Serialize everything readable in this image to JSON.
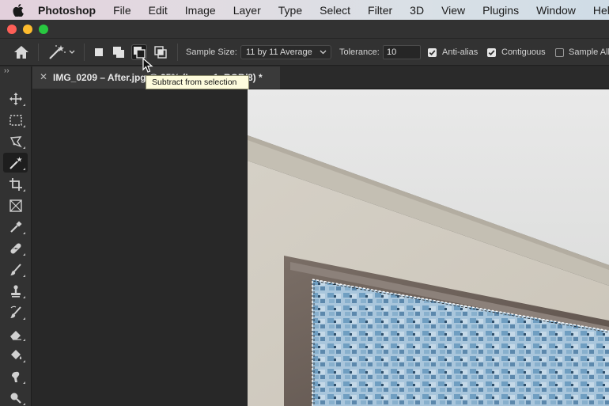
{
  "menubar": {
    "app_name": "Photoshop",
    "items": [
      "File",
      "Edit",
      "Image",
      "Layer",
      "Type",
      "Select",
      "Filter",
      "3D",
      "View",
      "Plugins",
      "Window",
      "Help"
    ]
  },
  "options_bar": {
    "sample_size_label": "Sample Size:",
    "sample_size_value": "11 by 11 Average",
    "tolerance_label": "Tolerance:",
    "tolerance_value": "10",
    "anti_alias_label": "Anti-alias",
    "anti_alias_checked": true,
    "contiguous_label": "Contiguous",
    "contiguous_checked": true,
    "sample_all_label": "Sample All",
    "sample_all_checked": false,
    "selection_modes": [
      "new-selection",
      "add-to-selection",
      "subtract-from-selection",
      "intersect-with-selection"
    ],
    "active_mode": "subtract-from-selection"
  },
  "tooltip": {
    "text": "Subtract from selection"
  },
  "document": {
    "tab_title": "IMG_0209 – After.jpg @ 25% (Layer 1, RGB/8) *"
  },
  "tools": [
    "move-tool",
    "marquee-tool",
    "lasso-tool",
    "magic-wand-tool",
    "crop-tool",
    "frame-tool",
    "eyedropper-tool",
    "healing-brush-tool",
    "brush-tool",
    "clone-stamp-tool",
    "history-brush-tool",
    "eraser-tool",
    "paint-bucket-tool",
    "smudge-tool",
    "dodge-tool"
  ],
  "active_tool": "magic-wand-tool",
  "colors": {
    "ui_panel": "#323232",
    "canvas_bg": "#282828",
    "tooltip_bg": "#fdfbdc",
    "traffic_close": "#fe5f57",
    "traffic_min": "#febc2e",
    "traffic_max": "#28c840"
  }
}
